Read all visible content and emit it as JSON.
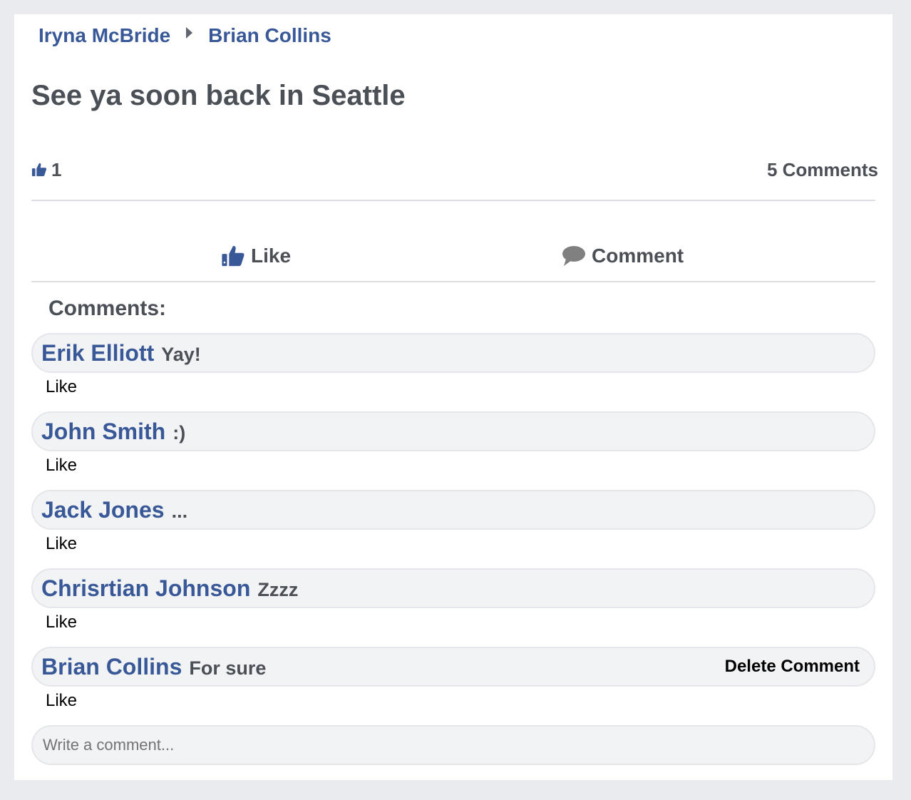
{
  "breadcrumb": {
    "from_user": "Iryna McBride",
    "to_user": "Brian Collins"
  },
  "post": {
    "title": "See ya soon back in Seattle",
    "like_count": "1",
    "comments_count_label": "5 Comments"
  },
  "actions": {
    "like_label": "Like",
    "comment_label": "Comment"
  },
  "comments_section": {
    "heading": "Comments:",
    "items": [
      {
        "author": "Erik Elliott",
        "text": "Yay!",
        "like_label": "Like"
      },
      {
        "author": "John Smith",
        "text": ":)",
        "like_label": "Like"
      },
      {
        "author": "Jack Jones",
        "text": "...",
        "like_label": "Like"
      },
      {
        "author": "Chrisrtian Johnson",
        "text": "Zzzz",
        "like_label": "Like"
      },
      {
        "author": "Brian Collins",
        "text": "For sure",
        "like_label": "Like",
        "delete_label": "Delete Comment"
      }
    ]
  },
  "composer": {
    "placeholder": "Write a comment..."
  },
  "colors": {
    "brand_blue": "#385898",
    "text_gray": "#4b4f56",
    "page_bg": "#e9ebee",
    "bubble_bg": "#f2f3f5"
  },
  "icons": {
    "like": "thumbs-up-icon",
    "comment": "speech-bubble-icon",
    "breadcrumb_separator": "caret-right-icon"
  }
}
